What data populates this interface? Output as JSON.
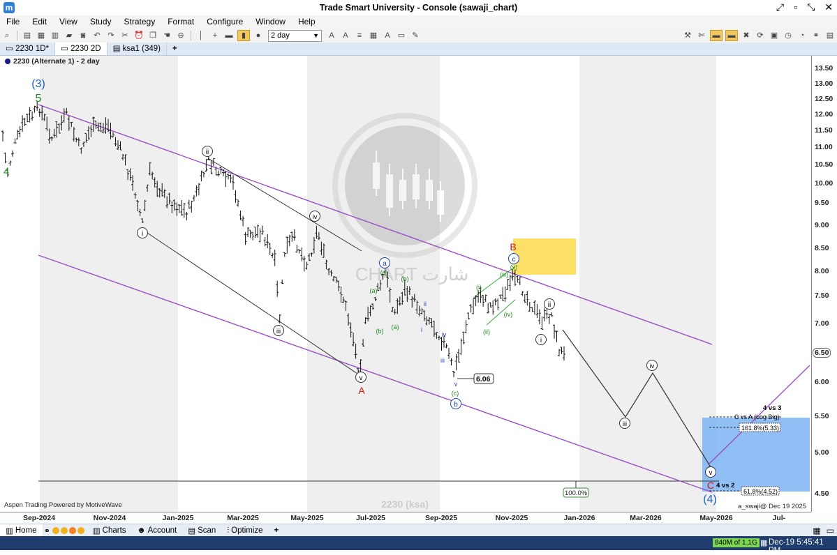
{
  "window": {
    "title": "Trade Smart University - Console (sawaji_chart)",
    "app_icon": "m"
  },
  "menu": [
    "File",
    "Edit",
    "View",
    "Study",
    "Strategy",
    "Format",
    "Configure",
    "Window",
    "Help"
  ],
  "toolbar": {
    "bar_size": "2 day"
  },
  "tabs": [
    {
      "label": "2230 1D*"
    },
    {
      "label": "2230 2D"
    },
    {
      "label": "ksa1 (349)"
    }
  ],
  "tab_add": "+",
  "chart": {
    "legend": "2230 (Alternate 1) - 2 day",
    "watermark_text": "CHART شارت",
    "symbol_watermark": "2230 (ksa)",
    "footer_left": "Aspen Trading Powered by MotiveWave",
    "footer_right": "a_swaji@ Dec 19 2025",
    "price_label": "6.06",
    "current_price": "6.50",
    "label_100": "100.0%",
    "fib_1618": "161.8%(5.33)",
    "fib_618": "61.8%(4.52)",
    "label_4vs3": "4 vs 3",
    "label_c_vs_a": "C vs A (Log Big)",
    "label_4vs2": "4 vs 2",
    "colors": {
      "channel": "#9b4fc6",
      "target_box": "#7db4f5",
      "highlight": "#ffe066",
      "wave_red": "#e01010",
      "wave_blue": "#1a3fb0",
      "wave_green": "#1e8a1e"
    },
    "wave_labels": {
      "w3": "(3)",
      "w4": "(4)",
      "w5": "5",
      "w4_left": "4",
      "A": "A",
      "B": "B",
      "C": "C",
      "roman_i": "i",
      "roman_ii": "ii",
      "roman_iii": "iii",
      "roman_iv": "iv",
      "roman_v": "v",
      "a": "a",
      "b": "b",
      "c": "c",
      "small_a": "(a)",
      "small_b": "(b)",
      "small_c": "(c)",
      "small_i": "(i)",
      "small_ii": "(ii)",
      "small_iii": "(iii)",
      "small_iv": "(iv)",
      "small_v": "(v)",
      "minor_i": "i",
      "minor_ii": "ii",
      "minor_iii": "iii",
      "minor_iv": "iv",
      "minor_v": "v"
    }
  },
  "y_axis": [
    "13.50",
    "13.00",
    "12.50",
    "12.00",
    "11.50",
    "11.00",
    "10.50",
    "10.00",
    "9.50",
    "9.00",
    "8.50",
    "8.00",
    "7.50",
    "7.00",
    "6.50",
    "6.00",
    "5.50",
    "5.00",
    "4.50"
  ],
  "x_axis": [
    "Sep-2024",
    "Nov-2024",
    "Jan-2025",
    "Mar-2025",
    "May-2025",
    "Jul-2025",
    "Sep-2025",
    "Nov-2025",
    "Jan-2026",
    "Mar-2026",
    "May-2026",
    "Jul-2026"
  ],
  "bottom_tabs": [
    "Home",
    "Charts",
    "Account",
    "Scan",
    "Optimize"
  ],
  "bottom_add": "+",
  "status": {
    "memory": "840M of 1.1G",
    "clock": "Dec-19  5:45:41 PM"
  }
}
